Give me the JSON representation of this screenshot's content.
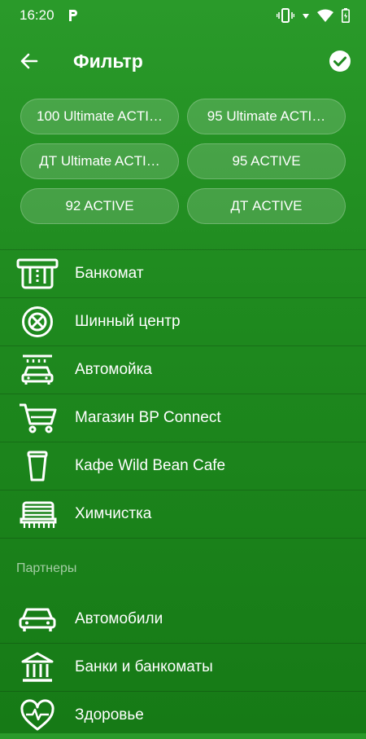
{
  "status_bar": {
    "time": "16:20",
    "app_icon": "parking-p-icon"
  },
  "header": {
    "title": "Фильтр"
  },
  "fuel_chips": [
    "100 Ultimate ACTI…",
    "95 Ultimate ACTI…",
    "ДТ Ultimate ACTI…",
    "95 ACTIVE",
    "92 ACTIVE",
    "ДТ ACTIVE"
  ],
  "services": [
    {
      "label": "Банкомат",
      "icon": "atm-icon"
    },
    {
      "label": "Шинный центр",
      "icon": "tire-icon"
    },
    {
      "label": "Автомойка",
      "icon": "car-wash-icon"
    },
    {
      "label": "Магазин BP Connect",
      "icon": "shopping-cart-icon"
    },
    {
      "label": "Кафе Wild Bean Cafe",
      "icon": "coffee-cup-icon"
    },
    {
      "label": "Химчистка",
      "icon": "dry-cleaning-icon"
    }
  ],
  "partners": {
    "section_title": "Партнеры",
    "items": [
      {
        "label": "Автомобили",
        "icon": "car-icon"
      },
      {
        "label": "Банки и банкоматы",
        "icon": "bank-icon"
      },
      {
        "label": "Здоровье",
        "icon": "heart-pulse-icon"
      }
    ]
  }
}
